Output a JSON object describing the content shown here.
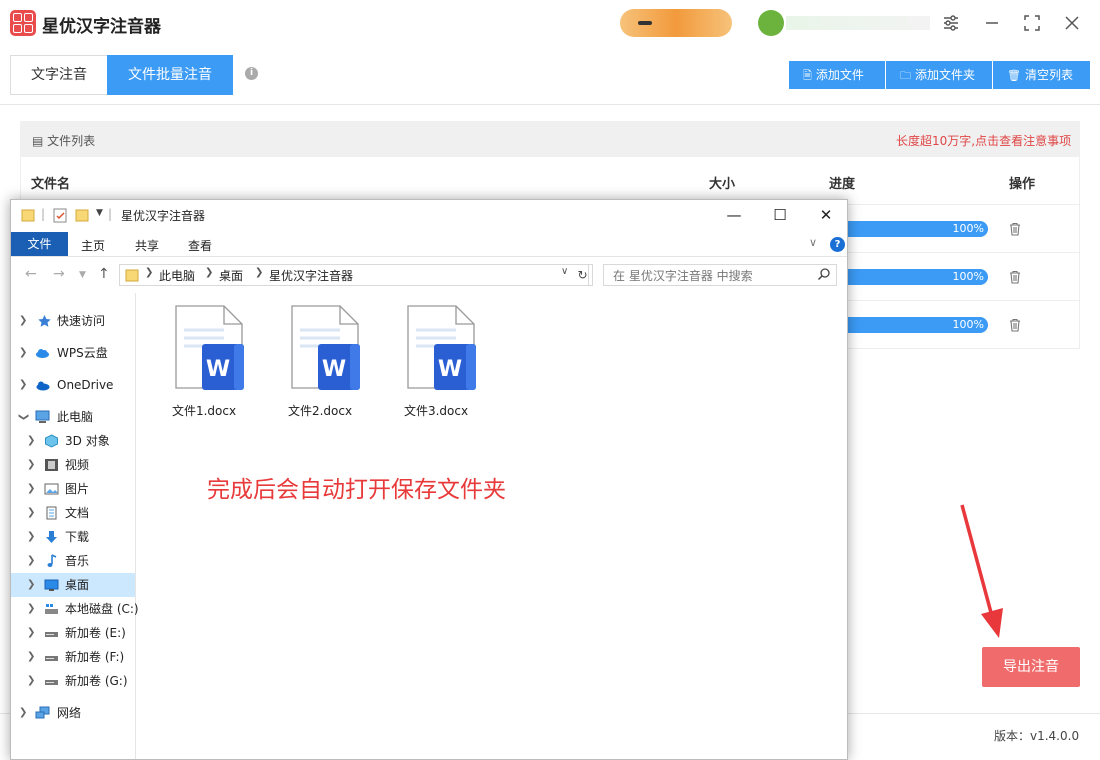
{
  "app": {
    "title": "星优汉字注音器",
    "tabs": [
      "文字注音",
      "文件批量注音"
    ],
    "toolbar": {
      "add_file": "添加文件",
      "add_folder": "添加文件夹",
      "clear_list": "清空列表"
    },
    "file_list": {
      "title": "文件列表",
      "notice": "长度超10万字,点击查看注意事项",
      "columns": {
        "name": "文件名",
        "size": "大小",
        "progress": "进度",
        "action": "操作"
      },
      "rows": [
        {
          "progress_label": "100%",
          "progress": 1.0
        },
        {
          "progress_label": "100%",
          "progress": 1.0
        },
        {
          "progress_label": "100%",
          "progress": 1.0
        }
      ]
    },
    "export_button": "导出注音",
    "version": "版本：v1.4.0.0",
    "colors": {
      "accent": "#3b9bf5",
      "export": "#f06c6c",
      "notice": "#e04646"
    }
  },
  "explorer": {
    "title": "星优汉字注音器",
    "ribbon": {
      "file": "文件",
      "home": "主页",
      "share": "共享",
      "view": "查看"
    },
    "breadcrumb": [
      "此电脑",
      "桌面",
      "星优汉字注音器"
    ],
    "search_placeholder": "在 星优汉字注音器 中搜索",
    "nav": [
      {
        "label": "快速访问",
        "icon": "star-icon"
      },
      {
        "label": "WPS云盘",
        "icon": "cloud-icon"
      },
      {
        "label": "OneDrive",
        "icon": "onedrive-icon"
      },
      {
        "label": "此电脑",
        "icon": "computer-icon"
      },
      {
        "label": "3D 对象",
        "icon": "cube-icon"
      },
      {
        "label": "视频",
        "icon": "video-icon"
      },
      {
        "label": "图片",
        "icon": "picture-icon"
      },
      {
        "label": "文档",
        "icon": "document-icon"
      },
      {
        "label": "下载",
        "icon": "download-icon"
      },
      {
        "label": "音乐",
        "icon": "music-icon"
      },
      {
        "label": "桌面",
        "icon": "desktop-icon"
      },
      {
        "label": "本地磁盘 (C:)",
        "icon": "drive-icon"
      },
      {
        "label": "新加卷 (E:)",
        "icon": "drive-icon"
      },
      {
        "label": "新加卷 (F:)",
        "icon": "drive-icon"
      },
      {
        "label": "新加卷 (G:)",
        "icon": "drive-icon"
      },
      {
        "label": "网络",
        "icon": "network-icon"
      }
    ],
    "files": [
      "文件1.docx",
      "文件2.docx",
      "文件3.docx"
    ],
    "note": "完成后会自动打开保存文件夹"
  }
}
